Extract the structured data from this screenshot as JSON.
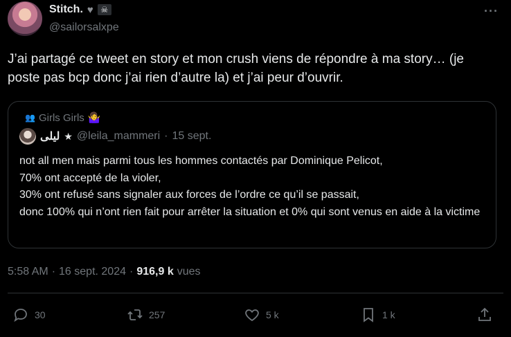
{
  "author": {
    "display_name": "Stitch.",
    "handle": "@sailorsalxpe",
    "badges": [
      "heart-icon",
      "skull-icon"
    ]
  },
  "tweet_text": "J’ai partagé ce tweet en story et mon crush viens de répondre à ma story… (je poste pas bcp donc j’ai rien d’autre la) et j’ai peur d’ouvrir.",
  "quote": {
    "community": "Girls Girls",
    "community_emoji": "🤷‍♀️",
    "name": "ليلى",
    "star": "★",
    "handle": "@leila_mammeri",
    "dot": "·",
    "date": "15 sept.",
    "lines": [
      "not all men mais parmi tous les hommes contactés par Dominique Pelicot,",
      "70% ont accepté de la violer,",
      "30% ont refusé sans signaler aux forces de l’ordre ce qu’il se passait,",
      "donc 100% qui n’ont rien fait pour arrêter la situation et 0% qui sont venus en aide à la victime"
    ]
  },
  "meta": {
    "time": "5:58 AM",
    "sep1": "·",
    "date": "16 sept. 2024",
    "sep2": "·",
    "views_count": "916,9 k",
    "views_label": "vues"
  },
  "actions": {
    "replies": "30",
    "retweets": "257",
    "likes": "5 k",
    "bookmarks": "1 k"
  }
}
